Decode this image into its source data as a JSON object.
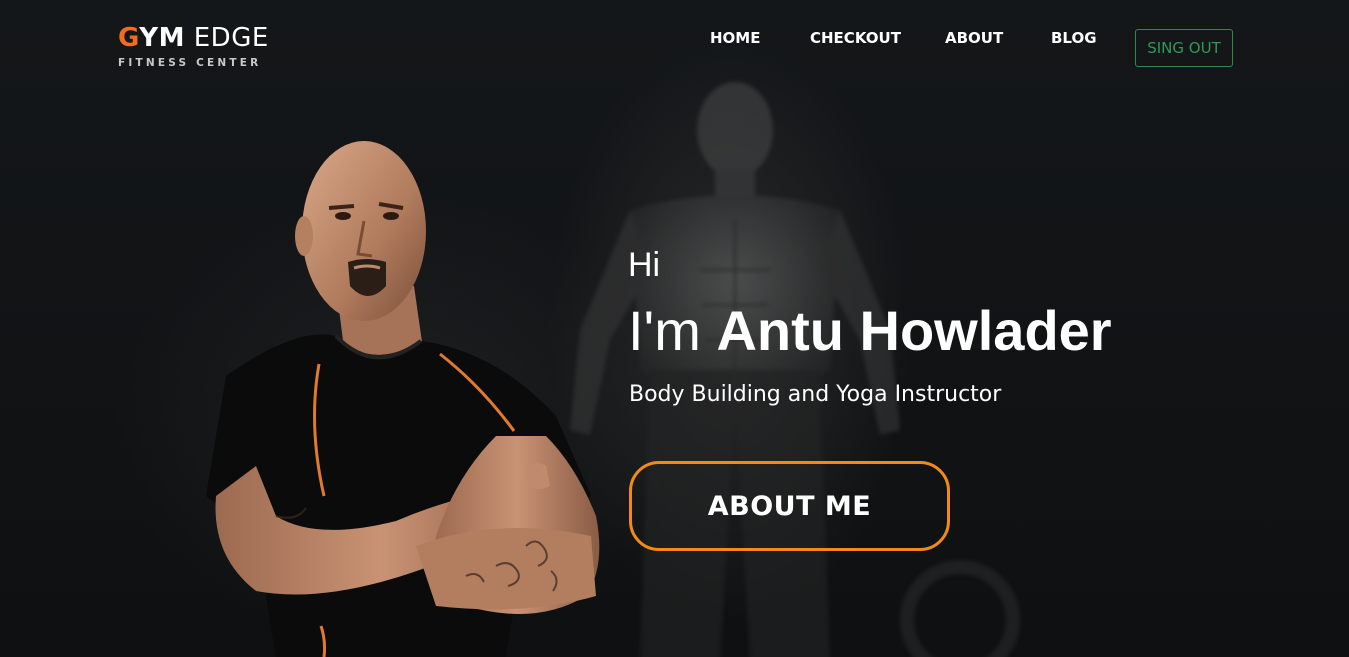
{
  "brand": {
    "logo_g": "G",
    "logo_ym": "YM",
    "logo_edge": " EDGE",
    "tagline": "FITNESS CENTER",
    "accent_color": "#f26b21"
  },
  "nav": {
    "home": "HOME",
    "checkout": "CHECKOUT",
    "about": "ABOUT",
    "blog": "BLOG",
    "signout": "SING OUT",
    "signout_color": "#2e9a57"
  },
  "hero": {
    "greeting": "Hi",
    "intro": "I'm ",
    "name": "Antu Howlader",
    "role": "Body Building and Yoga Instructor",
    "cta": "ABOUT ME",
    "cta_border_color": "#f28a1a"
  }
}
